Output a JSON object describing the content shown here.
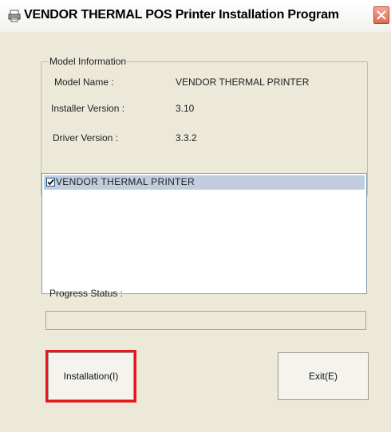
{
  "window": {
    "title": "VENDOR THERMAL POS Printer Installation Program",
    "icon": "printer-icon",
    "close_icon": "close-icon"
  },
  "model_info": {
    "legend": "Model Information",
    "rows": [
      {
        "label": "Model Name   :",
        "value": "VENDOR THERMAL PRINTER"
      },
      {
        "label": "Installer Version :",
        "value": "3.10"
      },
      {
        "label": "Driver Version   :",
        "value": "3.3.2"
      }
    ]
  },
  "printer_list": {
    "items": [
      {
        "label": "VENDOR THERMAL PRINTER",
        "checked": true
      }
    ]
  },
  "progress": {
    "label": "Progress Status :",
    "percent": 0
  },
  "buttons": {
    "install": "Installation(I)",
    "exit": "Exit(E)"
  },
  "colors": {
    "highlight": "#e8161d",
    "selection": "#c1cdde",
    "close_button": "#e06a55"
  }
}
